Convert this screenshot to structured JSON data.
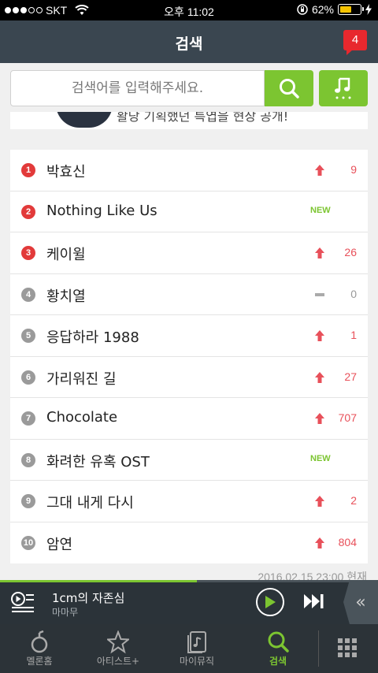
{
  "status_bar": {
    "carrier": "SKT",
    "time": "오후 11:02",
    "battery_percent": "62%",
    "battery_level": 0.62
  },
  "header": {
    "title": "검색",
    "notification_count": "4"
  },
  "search": {
    "placeholder": "검색어를 입력해주세요."
  },
  "banner": {
    "text": "활당 기획했던 특엽을 현장 공개!"
  },
  "ranking": {
    "items": [
      {
        "rank": "1",
        "keyword": "박효신",
        "trend": "up",
        "change": "9"
      },
      {
        "rank": "2",
        "keyword": "Nothing Like Us",
        "trend": "new",
        "change": "NEW"
      },
      {
        "rank": "3",
        "keyword": "케이윌",
        "trend": "up",
        "change": "26"
      },
      {
        "rank": "4",
        "keyword": "황치열",
        "trend": "same",
        "change": "0"
      },
      {
        "rank": "5",
        "keyword": "응답하라 1988",
        "trend": "up",
        "change": "1"
      },
      {
        "rank": "6",
        "keyword": "가리워진 길",
        "trend": "up",
        "change": "27"
      },
      {
        "rank": "7",
        "keyword": "Chocolate",
        "trend": "up",
        "change": "707"
      },
      {
        "rank": "8",
        "keyword": "화려한 유혹 OST",
        "trend": "new",
        "change": "NEW"
      },
      {
        "rank": "9",
        "keyword": "그대 내게 다시",
        "trend": "up",
        "change": "2"
      },
      {
        "rank": "10",
        "keyword": "암연",
        "trend": "up",
        "change": "804"
      }
    ],
    "timestamp": "2016.02.15 23:00 현재"
  },
  "player": {
    "song": "1cm의 자존심",
    "artist": "마마무",
    "progress": 0.52
  },
  "tabs": [
    {
      "label": "멜론홈",
      "icon": "melon-home-icon"
    },
    {
      "label": "아티스트+",
      "icon": "star-icon"
    },
    {
      "label": "마이뮤직",
      "icon": "my-music-icon"
    },
    {
      "label": "검색",
      "icon": "search-icon",
      "active": true
    }
  ],
  "colors": {
    "accent": "#7cc531",
    "header": "#3a4650",
    "up": "#e8505a",
    "rank_top": "#e23a3a",
    "rank_rest": "#9a9a9a"
  }
}
